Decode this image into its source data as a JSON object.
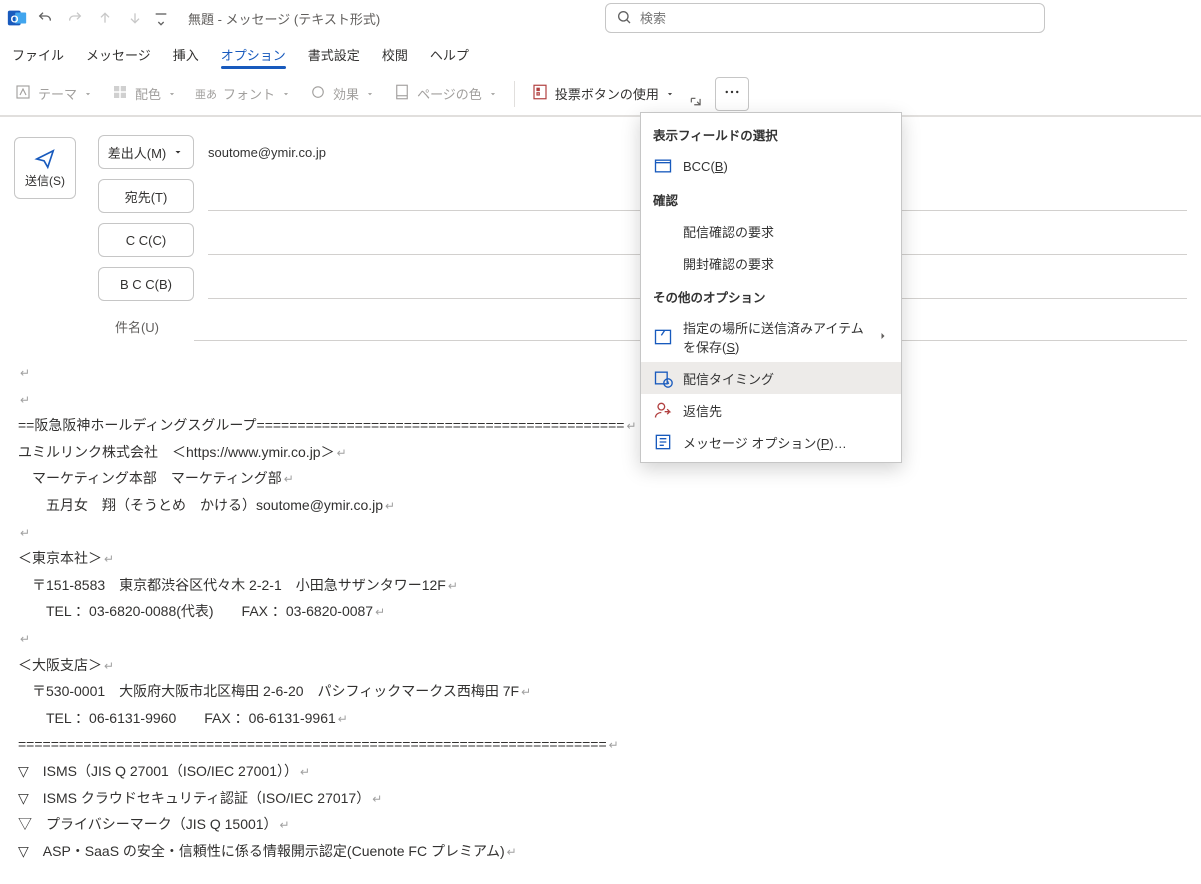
{
  "title": "無題 - メッセージ (テキスト形式)",
  "search_placeholder": "検索",
  "tabs": {
    "file": "ファイル",
    "message": "メッセージ",
    "insert": "挿入",
    "options": "オプション",
    "format": "書式設定",
    "review": "校閲",
    "help": "ヘルプ"
  },
  "ribbon": {
    "theme": "テーマ",
    "color": "配色",
    "font": "フォント",
    "font_prefix": "亜あ",
    "effects": "効果",
    "pagecolor": "ページの色",
    "voting": "投票ボタンの使用"
  },
  "dropdown": {
    "section_fields": "表示フィールドの選択",
    "bcc": "BCC(B)",
    "section_confirm": "確認",
    "delivery_receipt": "配信確認の要求",
    "read_receipt": "開封確認の要求",
    "section_other": "その他のオプション",
    "save_sent": "指定の場所に送信済みアイテムを保存(S)",
    "delay": "配信タイミング",
    "replyto": "返信先",
    "msgoptions": "メッセージ オプション(P)…"
  },
  "compose": {
    "send": "送信(S)",
    "from_btn": "差出人(M)",
    "from_value": "soutome@ymir.co.jp",
    "to": "宛先(T)",
    "cc": "C C(C)",
    "bcc": "B C C(B)",
    "subject": "件名(U)"
  },
  "body_lines": [
    "",
    "",
    "==阪急阪神ホールディングスグループ=============================================",
    "ユミルリンク株式会社　＜https://www.ymir.co.jp＞",
    "　マーケティング本部　マーケティング部",
    "　　五月女　翔（そうとめ　かける）soutome@ymir.co.jp",
    "",
    "＜東京本社＞",
    "　〒151-8583　東京都渋谷区代々木 2-2-1　小田急サザンタワー12F",
    "　　TEL ：03-6820-0088(代表)　　FAX ：03-6820-0087",
    "",
    "＜大阪支店＞",
    "　〒530-0001　大阪府大阪市北区梅田 2-6-20　パシフィックマークス西梅田 7F",
    "　　TEL ：06-6131-9960　　FAX ：06-6131-9961",
    "========================================================================",
    "▽　ISMS（JIS Q 27001（ISO/IEC 27001））",
    "▽　ISMS クラウドセキュリティ認証（ISO/IEC 27017）",
    "▽　プライバシーマーク（JIS Q 15001）",
    "▽　ASP・SaaS の安全・信頼性に係る情報開示認定(Cuenote FC プレミアム)"
  ]
}
